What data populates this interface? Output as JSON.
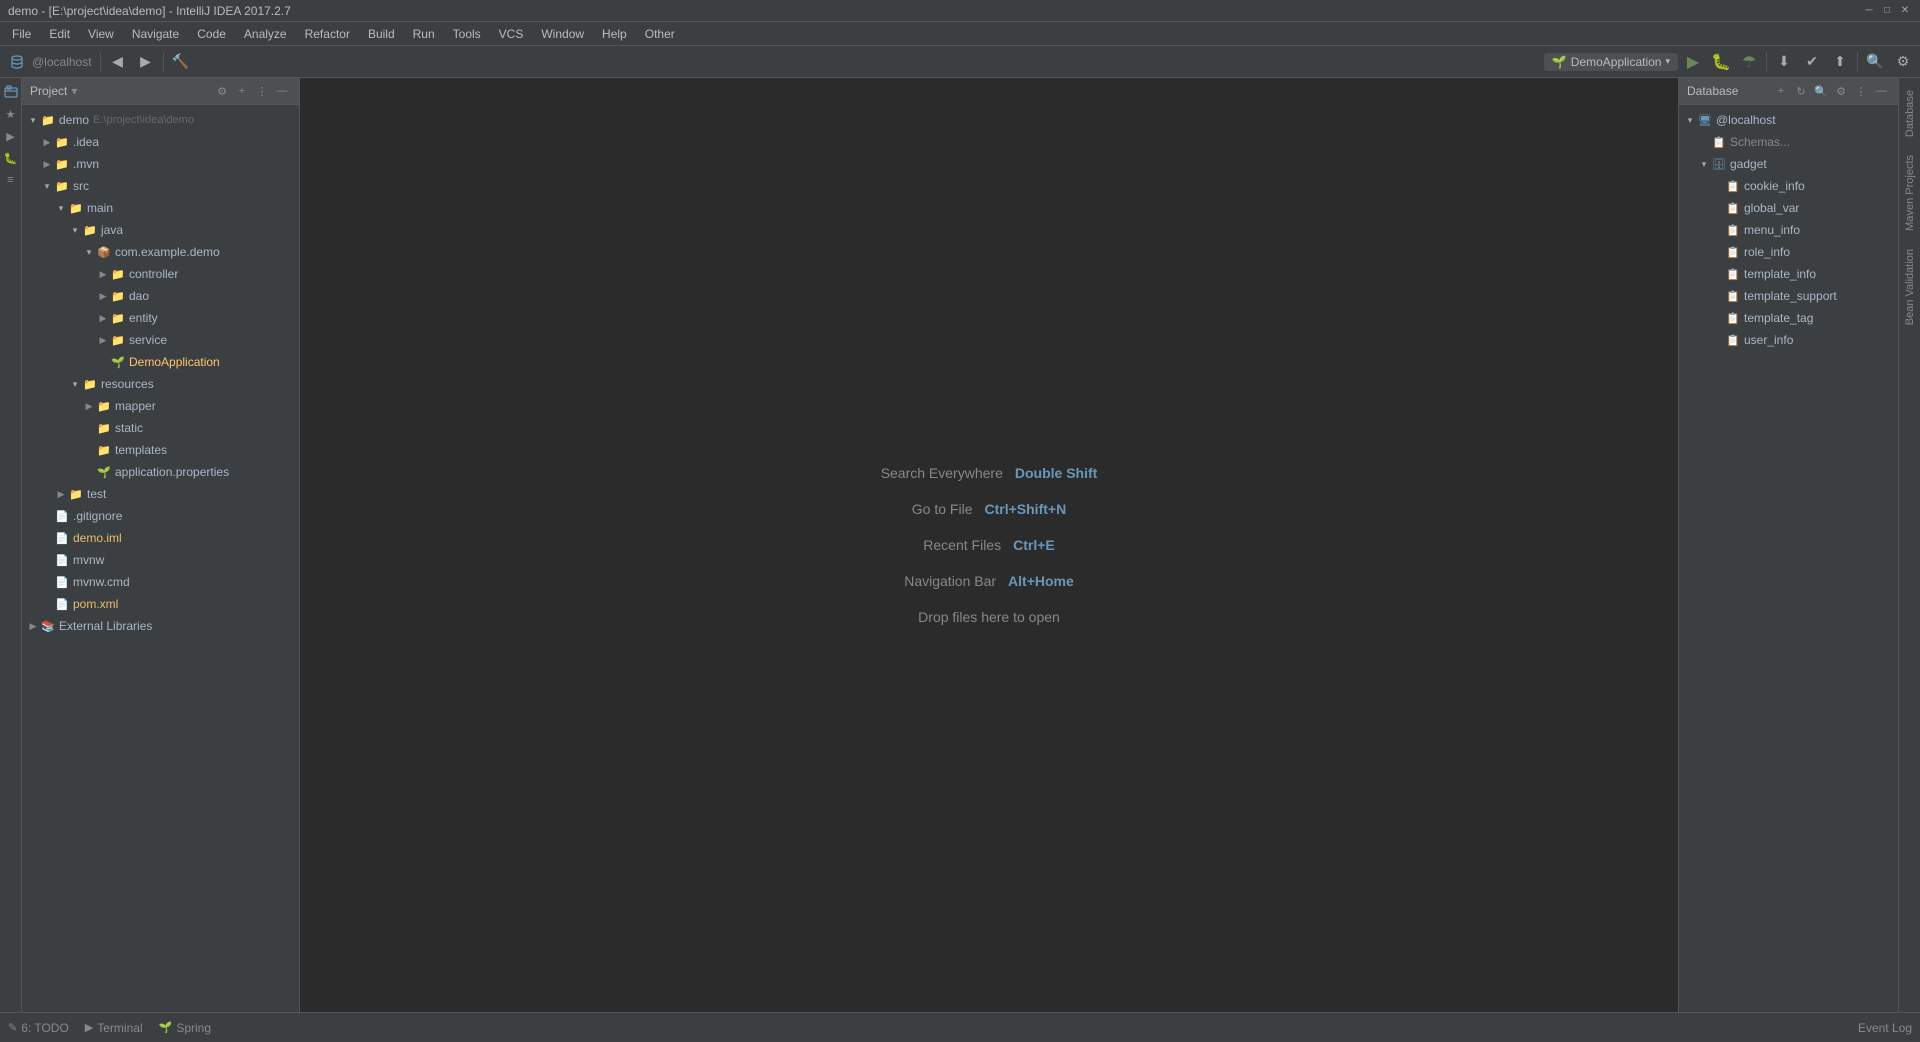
{
  "titleBar": {
    "title": " demo - [E:\\project\\idea\\demo] - IntelliJ IDEA 2017.2.7",
    "minimizeBtn": "─",
    "maximizeBtn": "□",
    "closeBtn": "✕"
  },
  "menuBar": {
    "items": [
      "File",
      "Edit",
      "View",
      "Navigate",
      "Code",
      "Analyze",
      "Refactor",
      "Build",
      "Run",
      "Tools",
      "VCS",
      "Window",
      "Help",
      "Other"
    ]
  },
  "toolbar": {
    "runConfig": "DemoApplication",
    "runBtnTitle": "Run",
    "debugBtnTitle": "Debug"
  },
  "projectPanel": {
    "title": "Project",
    "dropdown": "▾",
    "root": {
      "name": "demo",
      "path": "E:\\project\\idea\\demo",
      "children": [
        {
          "name": ".idea",
          "type": "dir",
          "indent": 1,
          "open": false
        },
        {
          "name": ".mvn",
          "type": "dir",
          "indent": 1,
          "open": false
        },
        {
          "name": "src",
          "type": "dir",
          "indent": 1,
          "open": true,
          "children": [
            {
              "name": "main",
              "type": "dir",
              "indent": 2,
              "open": true,
              "children": [
                {
                  "name": "java",
                  "type": "dir",
                  "indent": 3,
                  "open": true,
                  "children": [
                    {
                      "name": "com.example.demo",
                      "type": "package",
                      "indent": 4,
                      "open": true,
                      "children": [
                        {
                          "name": "controller",
                          "type": "dir",
                          "indent": 5,
                          "open": false
                        },
                        {
                          "name": "dao",
                          "type": "dir",
                          "indent": 5,
                          "open": false
                        },
                        {
                          "name": "entity",
                          "type": "dir",
                          "indent": 5,
                          "open": false
                        },
                        {
                          "name": "service",
                          "type": "dir",
                          "indent": 5,
                          "open": false
                        },
                        {
                          "name": "DemoApplication",
                          "type": "spring-class",
                          "indent": 5
                        }
                      ]
                    }
                  ]
                },
                {
                  "name": "resources",
                  "type": "dir",
                  "indent": 3,
                  "open": true,
                  "children": [
                    {
                      "name": "mapper",
                      "type": "dir",
                      "indent": 4,
                      "open": false
                    },
                    {
                      "name": "static",
                      "type": "dir",
                      "indent": 4,
                      "open": false
                    },
                    {
                      "name": "templates",
                      "type": "dir",
                      "indent": 4,
                      "open": false
                    },
                    {
                      "name": "application.properties",
                      "type": "properties",
                      "indent": 4
                    }
                  ]
                }
              ]
            },
            {
              "name": "test",
              "type": "dir",
              "indent": 2,
              "open": false
            }
          ]
        },
        {
          "name": ".gitignore",
          "type": "config",
          "indent": 1
        },
        {
          "name": "demo.iml",
          "type": "xml",
          "indent": 1
        },
        {
          "name": "mvnw",
          "type": "config",
          "indent": 1
        },
        {
          "name": "mvnw.cmd",
          "type": "config",
          "indent": 1
        },
        {
          "name": "pom.xml",
          "type": "xml",
          "indent": 1
        }
      ]
    },
    "externalLibraries": "External Libraries"
  },
  "editor": {
    "hints": [
      {
        "label": "Search Everywhere",
        "shortcut": "Double Shift"
      },
      {
        "label": "Go to File",
        "shortcut": "Ctrl+Shift+N"
      },
      {
        "label": "Recent Files",
        "shortcut": "Ctrl+E"
      },
      {
        "label": "Navigation Bar",
        "shortcut": "Alt+Home"
      }
    ],
    "dropText": "Drop files here to open"
  },
  "database": {
    "panelTitle": "Database",
    "localhost": "@localhost",
    "schemas": "Schemas...",
    "tables": [
      {
        "name": "gadget",
        "type": "schema",
        "indent": 1,
        "open": true,
        "children": [
          {
            "name": "cookie_info",
            "type": "table",
            "indent": 2
          },
          {
            "name": "global_var",
            "type": "table",
            "indent": 2
          },
          {
            "name": "menu_info",
            "type": "table",
            "indent": 2
          },
          {
            "name": "role_info",
            "type": "table",
            "indent": 2
          },
          {
            "name": "template_info",
            "type": "table",
            "indent": 2
          },
          {
            "name": "template_support",
            "type": "table",
            "indent": 2
          },
          {
            "name": "template_tag",
            "type": "table",
            "indent": 2
          },
          {
            "name": "user_info",
            "type": "table",
            "indent": 2
          }
        ]
      }
    ]
  },
  "statusBar": {
    "todo": "6: TODO",
    "terminal": "Terminal",
    "spring": "Spring",
    "eventLog": "Event Log"
  },
  "rightSidebarTabs": [
    "Database",
    "Maven Projects",
    "Bean Validation"
  ],
  "leftSidebarTabs": [
    "1: Project",
    "2: Favorites",
    "Structure"
  ]
}
